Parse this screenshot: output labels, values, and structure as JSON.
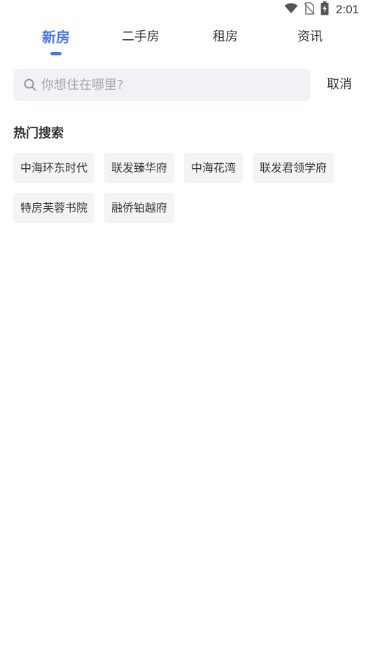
{
  "status_bar": {
    "time": "2:01",
    "icons": [
      "wifi-icon",
      "no-sim-icon",
      "battery-charging-icon"
    ]
  },
  "tabs": [
    {
      "label": "新房",
      "active": true
    },
    {
      "label": "二手房",
      "active": false
    },
    {
      "label": "租房",
      "active": false
    },
    {
      "label": "资讯",
      "active": false
    }
  ],
  "search": {
    "placeholder": "你想住在哪里?",
    "value": "",
    "cancel_label": "取消"
  },
  "hot_search": {
    "title": "热门搜索",
    "tags": [
      "中海环东时代",
      "联发臻华府",
      "中海花湾",
      "联发君领学府",
      "特房芙蓉书院",
      "融侨铂越府"
    ]
  },
  "colors": {
    "accent": "#4a7ae0",
    "search_bg": "#f1f2f5",
    "tag_bg": "#f4f4f6",
    "text": "#333333",
    "placeholder": "#a3a6ad"
  }
}
